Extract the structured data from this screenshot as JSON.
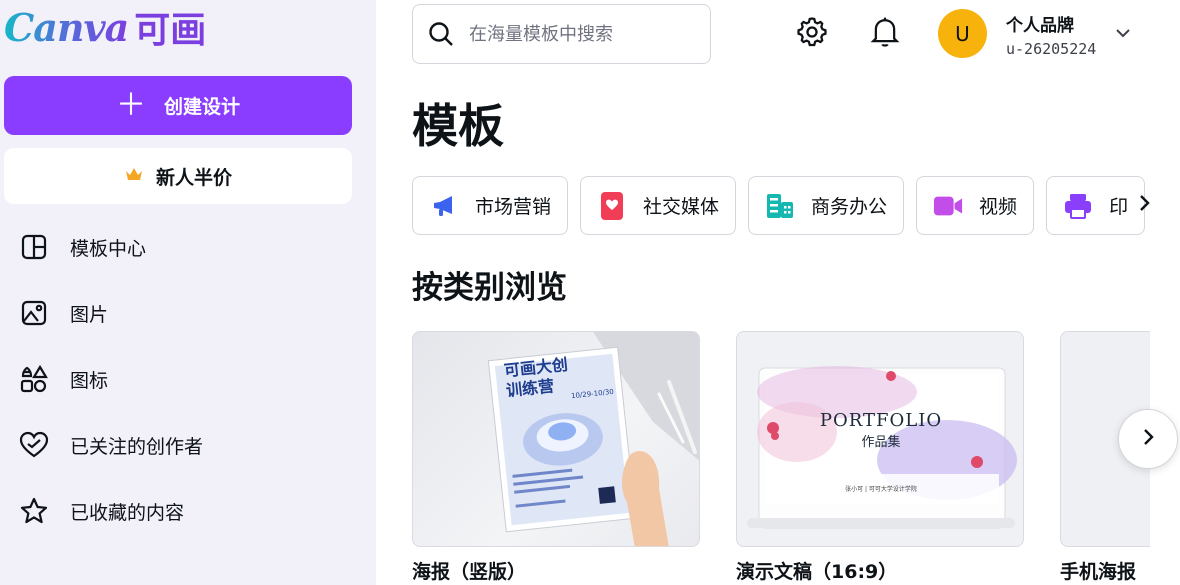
{
  "brand": {
    "logo_text": "Canva",
    "logo_cn": "可画"
  },
  "sidebar": {
    "create_label": "创建设计",
    "promo_label": "新人半价",
    "items": [
      {
        "label": "模板中心",
        "icon": "layout-icon"
      },
      {
        "label": "图片",
        "icon": "image-icon"
      },
      {
        "label": "图标",
        "icon": "shapes-icon"
      },
      {
        "label": "已关注的创作者",
        "icon": "heart-icon"
      },
      {
        "label": "已收藏的内容",
        "icon": "star-icon"
      }
    ]
  },
  "header": {
    "search_placeholder": "在海量模板中搜索",
    "avatar_initial": "U",
    "account_name": "个人品牌",
    "account_id": "u-26205224"
  },
  "main": {
    "title": "模板",
    "categories": [
      {
        "label": "市场营销",
        "icon": "megaphone-icon",
        "color": "#3b63f0"
      },
      {
        "label": "社交媒体",
        "icon": "social-heart-icon",
        "color": "#f23d57"
      },
      {
        "label": "商务办公",
        "icon": "building-icon",
        "color": "#14b8b1"
      },
      {
        "label": "视频",
        "icon": "video-icon",
        "color": "#c24de8"
      },
      {
        "label": "印",
        "icon": "printer-icon",
        "color": "#8a3ffc"
      }
    ],
    "section_title": "按类别浏览",
    "cards": [
      {
        "title": "海报（竖版）",
        "poster_line1": "可画大创",
        "poster_line2": "训练营",
        "poster_date": "10/29-10/30"
      },
      {
        "title": "演示文稿（16:9）",
        "slide_title": "PORTFOLIO",
        "slide_subtitle": "作品集",
        "slide_footer": "张小可 | 可可大学设计学院"
      },
      {
        "title": "手机海报"
      }
    ]
  },
  "colors": {
    "accent": "#8b3dff",
    "sidebar_bg": "#f2f1f9",
    "avatar": "#f7b20c"
  }
}
